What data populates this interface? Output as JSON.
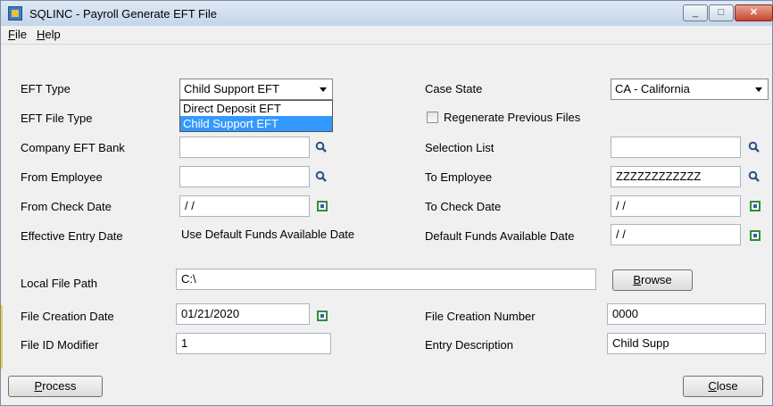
{
  "window": {
    "title": "SQLINC - Payroll Generate EFT File"
  },
  "menu": {
    "file": "File",
    "file_u": "F",
    "file_rest": "ile",
    "help": "Help",
    "help_u": "H",
    "help_rest": "elp"
  },
  "form": {
    "eft_type_label": "EFT Type",
    "eft_type_value": "Child Support EFT",
    "eft_type_options": [
      "Direct Deposit EFT",
      "Child Support EFT"
    ],
    "eft_file_type_label": "EFT File Type",
    "company_bank_label": "Company EFT Bank",
    "company_bank_value": "",
    "from_employee_label": "From Employee",
    "from_employee_value": "",
    "from_check_date_label": "From Check Date",
    "from_check_date_value": " / /",
    "effective_entry_date_label": "Effective Entry Date",
    "effective_entry_date_value": "Use Default Funds Available Date",
    "local_file_path_label": "Local File Path",
    "local_file_path_value": "C:\\",
    "file_creation_date_label": "File Creation Date",
    "file_creation_date_value": "01/21/2020",
    "file_id_modifier_label": "File ID Modifier",
    "file_id_modifier_value": "1",
    "case_state_label": "Case State",
    "case_state_value": "CA - California",
    "regenerate_label": "Regenerate Previous Files",
    "selection_list_label": "Selection List",
    "selection_list_value": "",
    "to_employee_label": "To Employee",
    "to_employee_value": "ZZZZZZZZZZZZ",
    "to_check_date_label": "To Check Date",
    "to_check_date_value": " / /",
    "default_funds_label": "Default Funds Available Date",
    "default_funds_value": " / /",
    "file_creation_number_label": "File Creation Number",
    "file_creation_number_value": "0000",
    "entry_description_label": "Entry Description",
    "entry_description_value": "Child Supp"
  },
  "buttons": {
    "browse_u": "B",
    "browse_rest": "rowse",
    "process_u": "P",
    "process_rest": "rocess",
    "close_u": "C",
    "close_rest": "lose"
  }
}
